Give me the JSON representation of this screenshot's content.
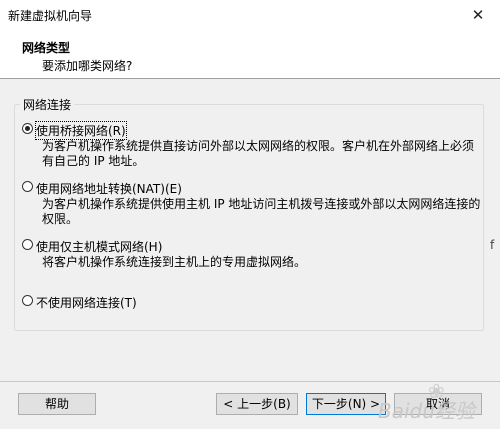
{
  "window": {
    "title": "新建虚拟机向导",
    "close_glyph": "✕"
  },
  "header": {
    "title": "网络类型",
    "subtitle": "要添加哪类网络?"
  },
  "group": {
    "label": "网络连接"
  },
  "options": [
    {
      "label": "使用桥接网络(R)",
      "checked": true,
      "description": "为客户机操作系统提供直接访问外部以太网网络的权限。客户机在外部网络上必须有自己的 IP 地址。"
    },
    {
      "label": "使用网络地址转换(NAT)(E)",
      "checked": false,
      "description": "为客户机操作系统提供使用主机 IP 地址访问主机拨号连接或外部以太网网络连接的权限。"
    },
    {
      "label": "使用仅主机模式网络(H)",
      "checked": false,
      "description": "将客户机操作系统连接到主机上的专用虚拟网络。"
    },
    {
      "label": "不使用网络连接(T)",
      "checked": false,
      "description": ""
    }
  ],
  "stray_glyph": "f",
  "buttons": {
    "help": "帮助",
    "back": "< 上一步(B)",
    "next": "下一步(N) >",
    "cancel": "取消"
  },
  "watermark": {
    "text": "Baidu经验"
  }
}
